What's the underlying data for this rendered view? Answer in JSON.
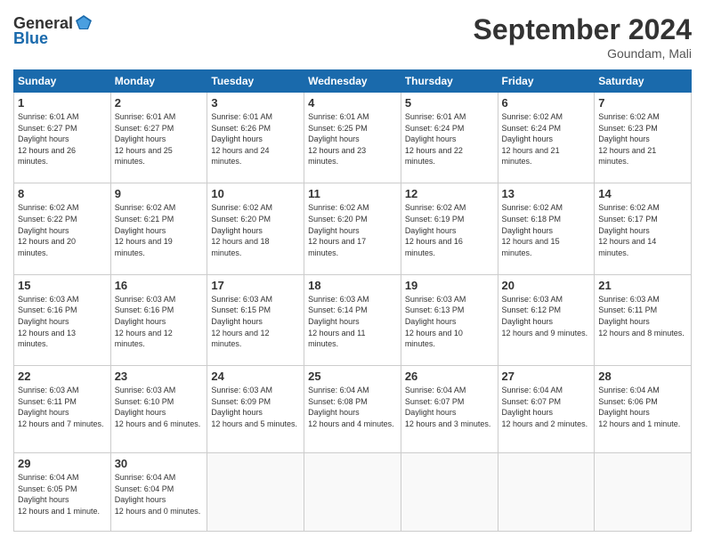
{
  "header": {
    "logo_general": "General",
    "logo_blue": "Blue",
    "title": "September 2024",
    "location": "Goundam, Mali"
  },
  "days_of_week": [
    "Sunday",
    "Monday",
    "Tuesday",
    "Wednesday",
    "Thursday",
    "Friday",
    "Saturday"
  ],
  "weeks": [
    [
      {
        "day": "1",
        "sunrise": "6:01 AM",
        "sunset": "6:27 PM",
        "daylight": "12 hours and 26 minutes."
      },
      {
        "day": "2",
        "sunrise": "6:01 AM",
        "sunset": "6:27 PM",
        "daylight": "12 hours and 25 minutes."
      },
      {
        "day": "3",
        "sunrise": "6:01 AM",
        "sunset": "6:26 PM",
        "daylight": "12 hours and 24 minutes."
      },
      {
        "day": "4",
        "sunrise": "6:01 AM",
        "sunset": "6:25 PM",
        "daylight": "12 hours and 23 minutes."
      },
      {
        "day": "5",
        "sunrise": "6:01 AM",
        "sunset": "6:24 PM",
        "daylight": "12 hours and 22 minutes."
      },
      {
        "day": "6",
        "sunrise": "6:02 AM",
        "sunset": "6:24 PM",
        "daylight": "12 hours and 21 minutes."
      },
      {
        "day": "7",
        "sunrise": "6:02 AM",
        "sunset": "6:23 PM",
        "daylight": "12 hours and 21 minutes."
      }
    ],
    [
      {
        "day": "8",
        "sunrise": "6:02 AM",
        "sunset": "6:22 PM",
        "daylight": "12 hours and 20 minutes."
      },
      {
        "day": "9",
        "sunrise": "6:02 AM",
        "sunset": "6:21 PM",
        "daylight": "12 hours and 19 minutes."
      },
      {
        "day": "10",
        "sunrise": "6:02 AM",
        "sunset": "6:20 PM",
        "daylight": "12 hours and 18 minutes."
      },
      {
        "day": "11",
        "sunrise": "6:02 AM",
        "sunset": "6:20 PM",
        "daylight": "12 hours and 17 minutes."
      },
      {
        "day": "12",
        "sunrise": "6:02 AM",
        "sunset": "6:19 PM",
        "daylight": "12 hours and 16 minutes."
      },
      {
        "day": "13",
        "sunrise": "6:02 AM",
        "sunset": "6:18 PM",
        "daylight": "12 hours and 15 minutes."
      },
      {
        "day": "14",
        "sunrise": "6:02 AM",
        "sunset": "6:17 PM",
        "daylight": "12 hours and 14 minutes."
      }
    ],
    [
      {
        "day": "15",
        "sunrise": "6:03 AM",
        "sunset": "6:16 PM",
        "daylight": "12 hours and 13 minutes."
      },
      {
        "day": "16",
        "sunrise": "6:03 AM",
        "sunset": "6:16 PM",
        "daylight": "12 hours and 12 minutes."
      },
      {
        "day": "17",
        "sunrise": "6:03 AM",
        "sunset": "6:15 PM",
        "daylight": "12 hours and 12 minutes."
      },
      {
        "day": "18",
        "sunrise": "6:03 AM",
        "sunset": "6:14 PM",
        "daylight": "12 hours and 11 minutes."
      },
      {
        "day": "19",
        "sunrise": "6:03 AM",
        "sunset": "6:13 PM",
        "daylight": "12 hours and 10 minutes."
      },
      {
        "day": "20",
        "sunrise": "6:03 AM",
        "sunset": "6:12 PM",
        "daylight": "12 hours and 9 minutes."
      },
      {
        "day": "21",
        "sunrise": "6:03 AM",
        "sunset": "6:11 PM",
        "daylight": "12 hours and 8 minutes."
      }
    ],
    [
      {
        "day": "22",
        "sunrise": "6:03 AM",
        "sunset": "6:11 PM",
        "daylight": "12 hours and 7 minutes."
      },
      {
        "day": "23",
        "sunrise": "6:03 AM",
        "sunset": "6:10 PM",
        "daylight": "12 hours and 6 minutes."
      },
      {
        "day": "24",
        "sunrise": "6:03 AM",
        "sunset": "6:09 PM",
        "daylight": "12 hours and 5 minutes."
      },
      {
        "day": "25",
        "sunrise": "6:04 AM",
        "sunset": "6:08 PM",
        "daylight": "12 hours and 4 minutes."
      },
      {
        "day": "26",
        "sunrise": "6:04 AM",
        "sunset": "6:07 PM",
        "daylight": "12 hours and 3 minutes."
      },
      {
        "day": "27",
        "sunrise": "6:04 AM",
        "sunset": "6:07 PM",
        "daylight": "12 hours and 2 minutes."
      },
      {
        "day": "28",
        "sunrise": "6:04 AM",
        "sunset": "6:06 PM",
        "daylight": "12 hours and 1 minute."
      }
    ],
    [
      {
        "day": "29",
        "sunrise": "6:04 AM",
        "sunset": "6:05 PM",
        "daylight": "12 hours and 1 minute."
      },
      {
        "day": "30",
        "sunrise": "6:04 AM",
        "sunset": "6:04 PM",
        "daylight": "12 hours and 0 minutes."
      },
      null,
      null,
      null,
      null,
      null
    ]
  ]
}
